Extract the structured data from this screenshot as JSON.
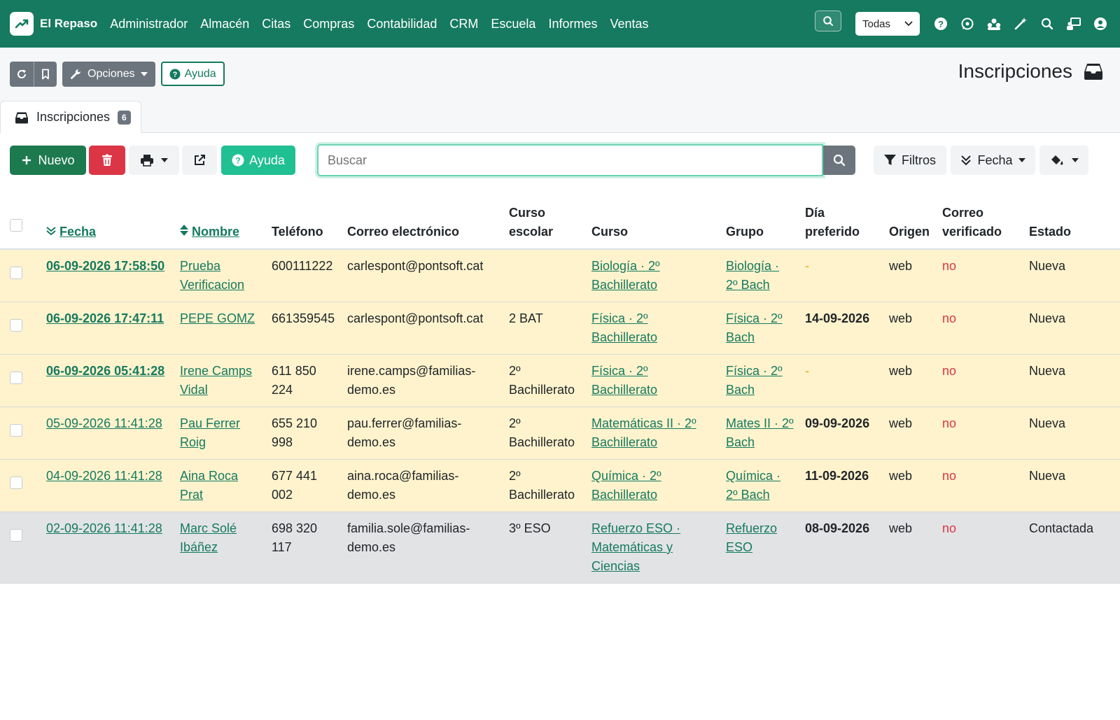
{
  "brand": {
    "name": "El Repaso"
  },
  "nav": {
    "items": [
      "Administrador",
      "Almacén",
      "Citas",
      "Compras",
      "Contabilidad",
      "CRM",
      "Escuela",
      "Informes",
      "Ventas"
    ],
    "select_value": "Todas"
  },
  "toolbar": {
    "options_label": "Opciones",
    "help_label": "Ayuda"
  },
  "page": {
    "title": "Inscripciones"
  },
  "tab": {
    "label": "Inscripciones",
    "count": "6"
  },
  "actions": {
    "new_label": "Nuevo",
    "help_label": "Ayuda",
    "search_placeholder": "Buscar",
    "filters_label": "Filtros",
    "date_label": "Fecha"
  },
  "table": {
    "headers": {
      "fecha": "Fecha",
      "nombre": "Nombre",
      "telefono": "Teléfono",
      "correo": "Correo electrónico",
      "curso_escolar_1": "Curso",
      "curso_escolar_2": "escolar",
      "curso": "Curso",
      "grupo": "Grupo",
      "dia_1": "Día",
      "dia_2": "preferido",
      "origen": "Origen",
      "verificado_1": "Correo",
      "verificado_2": "verificado",
      "estado": "Estado"
    },
    "rows": [
      {
        "fecha": "06-09-2026 17:58:50",
        "fecha_bold": true,
        "nombre": "Prueba Verificacion",
        "telefono": "600111222",
        "correo": "carlespont@pontsoft.cat",
        "curso_escolar": "",
        "curso": "Biología · 2º Bachillerato",
        "grupo": "Biología · 2º Bach",
        "dia": "-",
        "origen": "web",
        "verificado": "no",
        "estado": "Nueva",
        "status": "new"
      },
      {
        "fecha": "06-09-2026 17:47:11",
        "fecha_bold": true,
        "nombre": "PEPE GOMZ",
        "telefono": "661359545",
        "correo": "carlespont@pontsoft.cat",
        "curso_escolar": "2 BAT",
        "curso": "Física · 2º Bachillerato",
        "grupo": "Física · 2º Bach",
        "dia": "14-09-2026",
        "origen": "web",
        "verificado": "no",
        "estado": "Nueva",
        "status": "new"
      },
      {
        "fecha": "06-09-2026 05:41:28",
        "fecha_bold": true,
        "nombre": "Irene Camps Vidal",
        "telefono": "611 850 224",
        "correo": "irene.camps@familias-demo.es",
        "curso_escolar": "2º Bachillerato",
        "curso": "Física · 2º Bachillerato",
        "grupo": "Física · 2º Bach",
        "dia": "-",
        "origen": "web",
        "verificado": "no",
        "estado": "Nueva",
        "status": "new"
      },
      {
        "fecha": "05-09-2026 11:41:28",
        "fecha_bold": false,
        "nombre": "Pau Ferrer Roig",
        "telefono": "655 210 998",
        "correo": "pau.ferrer@familias-demo.es",
        "curso_escolar": "2º Bachillerato",
        "curso": "Matemáticas II · 2º Bachillerato",
        "grupo": "Mates II · 2º Bach",
        "dia": "09-09-2026",
        "origen": "web",
        "verificado": "no",
        "estado": "Nueva",
        "status": "new"
      },
      {
        "fecha": "04-09-2026 11:41:28",
        "fecha_bold": false,
        "nombre": "Aina Roca Prat",
        "telefono": "677 441 002",
        "correo": "aina.roca@familias-demo.es",
        "curso_escolar": "2º Bachillerato",
        "curso": "Química · 2º Bachillerato",
        "grupo": "Química · 2º Bach",
        "dia": "11-09-2026",
        "origen": "web",
        "verificado": "no",
        "estado": "Nueva",
        "status": "new"
      },
      {
        "fecha": "02-09-2026 11:41:28",
        "fecha_bold": false,
        "nombre": "Marc Solé Ibáñez",
        "telefono": "698 320 117",
        "correo": "familia.sole@familias-demo.es",
        "curso_escolar": "3º ESO",
        "curso": "Refuerzo ESO · Matemáticas y Ciencias",
        "grupo": "Refuerzo ESO",
        "dia": "08-09-2026",
        "origen": "web",
        "verificado": "no",
        "estado": "Contactada",
        "status": "contacted"
      }
    ]
  },
  "colors": {
    "primary": "#157a5f",
    "danger": "#dc3545",
    "teal": "#20c093",
    "row_new": "#fff3cd",
    "row_contacted": "#e2e3e5"
  }
}
